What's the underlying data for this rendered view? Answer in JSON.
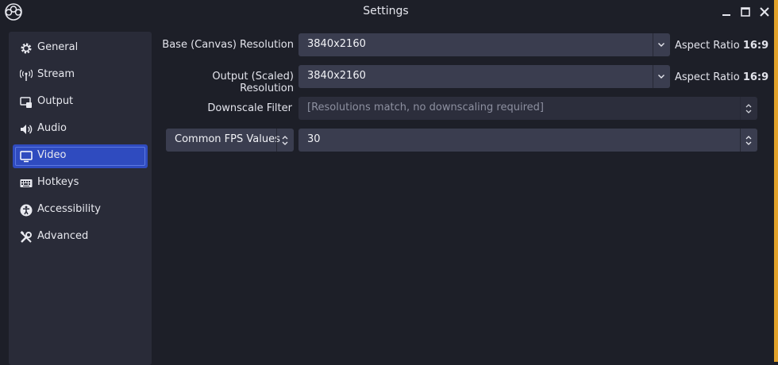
{
  "window": {
    "title": "Settings"
  },
  "colors": {
    "accent_active": "#2f4bbf",
    "frame_strip": "#e2a22b"
  },
  "sidebar": {
    "items": [
      {
        "label": "General",
        "icon": "gear-icon"
      },
      {
        "label": "Stream",
        "icon": "antenna-icon"
      },
      {
        "label": "Output",
        "icon": "output-icon"
      },
      {
        "label": "Audio",
        "icon": "speaker-icon"
      },
      {
        "label": "Video",
        "icon": "monitor-icon",
        "active": true
      },
      {
        "label": "Hotkeys",
        "icon": "keyboard-icon"
      },
      {
        "label": "Accessibility",
        "icon": "accessibility-icon"
      },
      {
        "label": "Advanced",
        "icon": "tools-icon"
      }
    ]
  },
  "video": {
    "base_resolution": {
      "label": "Base (Canvas) Resolution",
      "value": "3840x2160",
      "aspect_prefix": "Aspect Ratio",
      "aspect_value": "16:9"
    },
    "output_resolution": {
      "label": "Output (Scaled) Resolution",
      "value": "3840x2160",
      "aspect_prefix": "Aspect Ratio",
      "aspect_value": "16:9"
    },
    "downscale_filter": {
      "label": "Downscale Filter",
      "value": "[Resolutions match, no downscaling required]"
    },
    "fps": {
      "type_selector": "Common FPS Values",
      "value": "30"
    }
  }
}
